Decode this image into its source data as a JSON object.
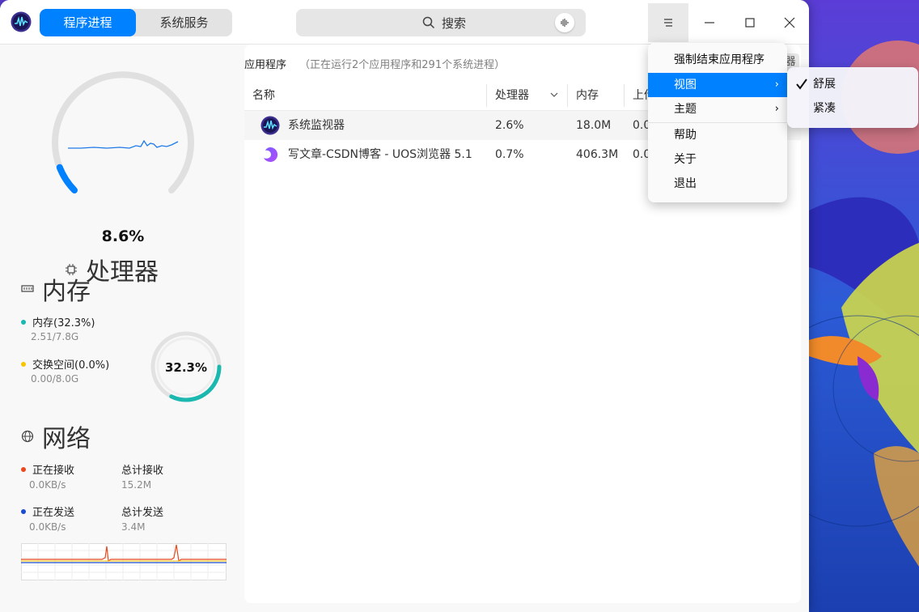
{
  "tabs": [
    {
      "label": "程序进程",
      "active": true
    },
    {
      "label": "系统服务",
      "active": false
    }
  ],
  "search": {
    "placeholder": "搜索"
  },
  "cpu": {
    "value": "8.6%",
    "fraction": 0.086,
    "title": "处理器"
  },
  "memory": {
    "title": "内存",
    "ram_label": "内存(32.3%)",
    "ram_value": "2.51/7.8G",
    "swap_label": "交换空间(0.0%)",
    "swap_value": "0.00/8.0G",
    "gauge_value": "32.3%",
    "fraction": 0.323
  },
  "network": {
    "title": "网络",
    "receiving_label": "正在接收",
    "receiving_value": "0.0KB/s",
    "total_received_label": "总计接收",
    "total_received_value": "15.2M",
    "sending_label": "正在发送",
    "sending_value": "0.0KB/s",
    "total_sent_label": "总计发送",
    "total_sent_value": "3.4M"
  },
  "main": {
    "title": "应用程序",
    "subtitle": "（正在运行2个应用程序和291个系统进程）",
    "view_icon": "器",
    "columns": [
      "名称",
      "处理器",
      "内存",
      "上传"
    ],
    "rows": [
      {
        "name": "系统监视器",
        "cpu": "2.6%",
        "mem": "18.0M",
        "up": "0.0",
        "icon": "system-monitor-icon"
      },
      {
        "name": "写文章-CSDN博客 - UOS浏览器 5.1",
        "cpu": "0.7%",
        "mem": "406.3M",
        "up": "0.0",
        "icon": "browser-icon"
      }
    ]
  },
  "menu": {
    "items": [
      "强制结束应用程序",
      "视图",
      "主题",
      "帮助",
      "关于",
      "退出"
    ],
    "highlighted": "视图",
    "view_submenu": [
      "舒展",
      "紧凑"
    ],
    "view_checked": "舒展"
  },
  "colors": {
    "accent": "#0081ff",
    "memory": "#1bb8b0",
    "swap": "#f7c600",
    "receive": "#e8491e",
    "send": "#1c4ccf"
  }
}
